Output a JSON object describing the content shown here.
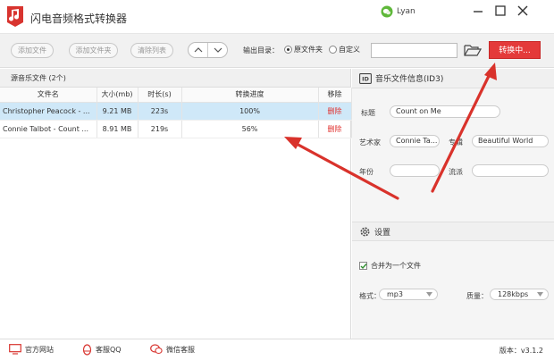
{
  "app": {
    "title": "闪电音频格式转换器",
    "user": "Lyan"
  },
  "toolbar": {
    "add_file": "添加文件",
    "add_folder": "添加文件夹",
    "clear_list": "清除列表",
    "output_dir_label": "输出目录：",
    "radio_source": "原文件夹",
    "radio_custom": "自定义",
    "path_value": "",
    "convert_label": "转换中..."
  },
  "files": {
    "title": "源音乐文件 (2个)",
    "columns": [
      "文件名",
      "大小(mb)",
      "时长(s)",
      "转换进度",
      "移除"
    ],
    "rows": [
      {
        "name": "Christopher Peacock - ...",
        "size": "9.21 MB",
        "duration": "223s",
        "progress": "100%",
        "remove": "删除"
      },
      {
        "name": "Connie Talbot - Count ...",
        "size": "8.91 MB",
        "duration": "219s",
        "progress": "56%",
        "remove": "删除"
      }
    ]
  },
  "info": {
    "title": "音乐文件信息(ID3)",
    "title_label": "标题",
    "title_value": "Count on Me",
    "artist_label": "艺术家",
    "artist_value": "Connie Ta...",
    "album_label": "专辑",
    "album_value": "Beautiful World",
    "year_label": "年份",
    "year_value": "",
    "genre_label": "流派",
    "genre_value": ""
  },
  "settings": {
    "title": "设置",
    "merge_label": "合并为一个文件",
    "merge_checked": true,
    "format_label": "格式：",
    "format_value": "mp3",
    "quality_label": "质量：",
    "quality_value": "128kbps"
  },
  "statusbar": {
    "website": "官方网站",
    "qq": "客服QQ",
    "wechat": "微信客服",
    "version": "版本：v3.1.2"
  },
  "colors": {
    "accent": "#e43a3a",
    "selected_row": "#cfe8f8",
    "arrow": "#d9322b"
  }
}
